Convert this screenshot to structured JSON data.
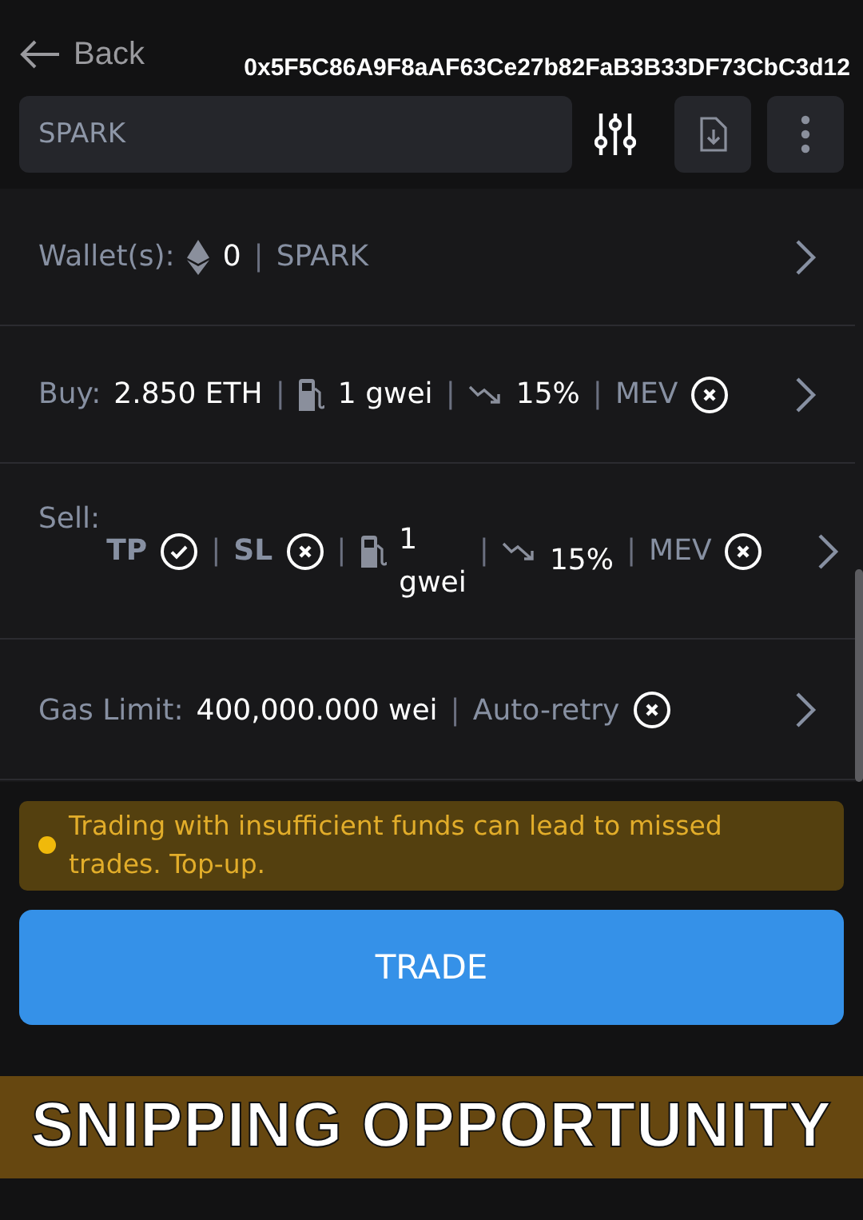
{
  "header": {
    "back": "Back",
    "address": "0x5F5C86A9F8aAF63Ce27b82FaB3B33DF73CbC3d12"
  },
  "search": {
    "value": "SPARK"
  },
  "settings": [
    {
      "label": "Wallet(s):",
      "parts": [
        {
          "kind": "eth-icon"
        },
        {
          "kind": "value",
          "text": "0"
        },
        {
          "kind": "sep",
          "text": "|"
        },
        {
          "kind": "option",
          "text": "SPARK"
        }
      ]
    },
    {
      "label": "Buy:",
      "parts": [
        {
          "kind": "value",
          "text": "2.850 ETH"
        },
        {
          "kind": "sep",
          "text": "|"
        },
        {
          "kind": "gas-icon"
        },
        {
          "kind": "value",
          "text": "1 gwei"
        },
        {
          "kind": "sep",
          "text": "|"
        },
        {
          "kind": "slippage-icon"
        },
        {
          "kind": "value",
          "text": "15%"
        },
        {
          "kind": "sep",
          "text": "|"
        },
        {
          "kind": "option",
          "text": "MEV"
        },
        {
          "kind": "toggle",
          "on": false
        }
      ]
    },
    {
      "label": "Sell:",
      "parts": [
        {
          "kind": "flag",
          "text": "TP"
        },
        {
          "kind": "toggle",
          "on": true
        },
        {
          "kind": "sep",
          "text": "|"
        },
        {
          "kind": "flag",
          "text": "SL"
        },
        {
          "kind": "toggle",
          "on": false
        },
        {
          "kind": "sep",
          "text": "|"
        },
        {
          "kind": "gas-icon"
        },
        {
          "kind": "value",
          "text": "1 gwei"
        },
        {
          "kind": "sep",
          "text": "|"
        },
        {
          "kind": "slippage-icon"
        },
        {
          "kind": "value",
          "text": "15%"
        },
        {
          "kind": "sep",
          "text": "|"
        },
        {
          "kind": "option",
          "text": "MEV"
        },
        {
          "kind": "toggle",
          "on": false
        }
      ]
    },
    {
      "label": "Gas Limit:",
      "parts": [
        {
          "kind": "value",
          "text": "400,000.000 wei"
        },
        {
          "kind": "sep",
          "text": "|"
        },
        {
          "kind": "option",
          "text": "Auto-retry"
        },
        {
          "kind": "toggle",
          "on": false
        }
      ]
    }
  ],
  "warning": "Trading with insufficient funds can lead to missed trades. Top-up.",
  "trade_button": "TRADE",
  "banner": "SNIPPING OPPORTUNITY"
}
